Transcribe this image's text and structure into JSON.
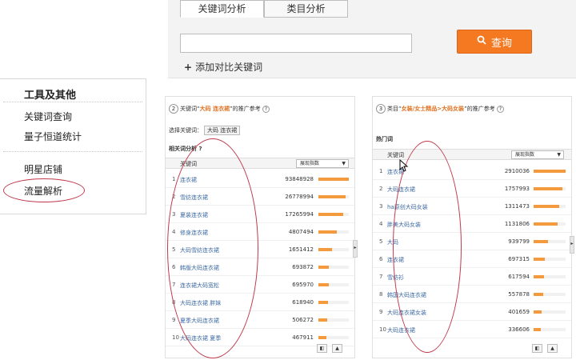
{
  "tabs": [
    "关键词分析",
    "类目分析"
  ],
  "search": {
    "button_label": "查询",
    "add_compare": "添加对比关键词"
  },
  "tools": {
    "title": "工具及其他",
    "items": [
      "关键词查询",
      "量子恒道统计",
      "明星店铺",
      "流量解析"
    ]
  },
  "left_panel": {
    "num": "2",
    "prefix": "关键词“",
    "keyword": "大码 连衣裙",
    "suffix": "”的推广参考",
    "select_label": "选择关键词：",
    "chip": "大码 连衣裙",
    "section": "相关词分析",
    "col_keyword": "关键词",
    "select_value": "展现指数",
    "rows": [
      {
        "rank": "1",
        "name": "连衣裙",
        "value": "93848928",
        "pct": 1.0
      },
      {
        "rank": "2",
        "name": "雪纺连衣裙",
        "value": "26778994",
        "pct": 0.9
      },
      {
        "rank": "3",
        "name": "夏装连衣裙",
        "value": "17265994",
        "pct": 0.82
      },
      {
        "rank": "4",
        "name": "修身连衣裙",
        "value": "4807494",
        "pct": 0.6
      },
      {
        "rank": "5",
        "name": "大码雪纺连衣裙",
        "value": "1651412",
        "pct": 0.45
      },
      {
        "rank": "6",
        "name": "韩版大码连衣裙",
        "value": "693872",
        "pct": 0.35
      },
      {
        "rank": "7",
        "name": "连衣裙大码宽松",
        "value": "695970",
        "pct": 0.35
      },
      {
        "rank": "8",
        "name": "大码连衣裙 胖妹",
        "value": "618940",
        "pct": 0.32
      },
      {
        "rank": "9",
        "name": "夏季大码连衣裙",
        "value": "506272",
        "pct": 0.28
      },
      {
        "rank": "10",
        "name": "大码连衣裙 夏季",
        "value": "467911",
        "pct": 0.25
      }
    ]
  },
  "right_panel": {
    "num": "3",
    "prefix": "类目“",
    "keyword": "女装/女士精品>大码女装",
    "suffix": "”的推广参考",
    "section": "热门词",
    "col_keyword": "关键词",
    "select_value": "展现指数",
    "rows": [
      {
        "rank": "1",
        "name": "连衣裙",
        "value": "2910036",
        "pct": 1.0
      },
      {
        "rank": "2",
        "name": "大码连衣裙",
        "value": "1757993",
        "pct": 0.9
      },
      {
        "rank": "3",
        "name": "ha原创大码女装",
        "value": "1311473",
        "pct": 0.8
      },
      {
        "rank": "4",
        "name": "胖美大码女装",
        "value": "1131806",
        "pct": 0.75
      },
      {
        "rank": "5",
        "name": "大码",
        "value": "939799",
        "pct": 0.45
      },
      {
        "rank": "6",
        "name": "连衣裙",
        "value": "697315",
        "pct": 0.35
      },
      {
        "rank": "7",
        "name": "雪纺衫",
        "value": "617594",
        "pct": 0.33
      },
      {
        "rank": "8",
        "name": "韩国大码连衣裙",
        "value": "557878",
        "pct": 0.3
      },
      {
        "rank": "9",
        "name": "大码连衣裙女装",
        "value": "401659",
        "pct": 0.25
      },
      {
        "rank": "10",
        "name": "大码连衣裙",
        "value": "336606",
        "pct": 0.22
      }
    ]
  },
  "colors": {
    "accent": "#f47920",
    "link": "#3d6aa3",
    "bar": "#f29a3c",
    "annotation": "#c0394a"
  }
}
